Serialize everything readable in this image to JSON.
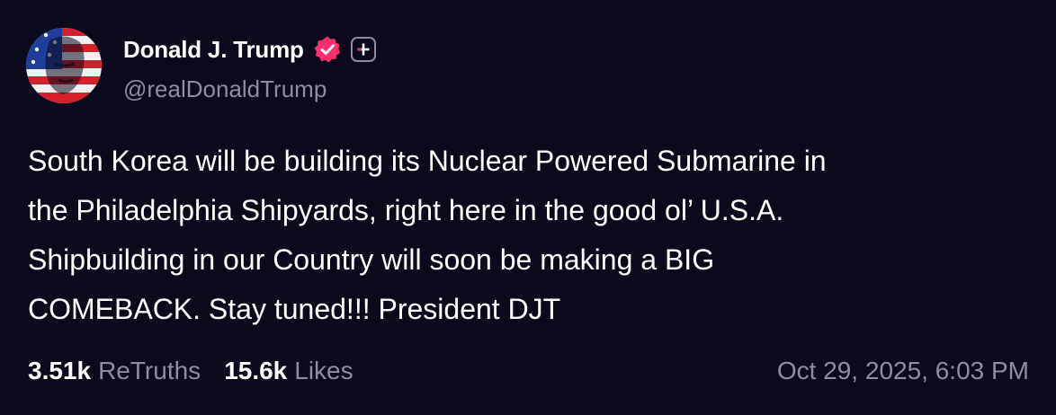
{
  "author": {
    "display_name": "Donald J. Trump",
    "handle": "@realDonaldTrump",
    "verified_icon": "verified-badge-icon",
    "plus_icon": "plus-badge-icon",
    "accent_color": "#ff2e6d"
  },
  "post": {
    "lines": [
      "South Korea will be building its Nuclear Powered Submarine in",
      "the Philadelphia Shipyards, right here in the good ol’ U.S.A.",
      "Shipbuilding in our Country will soon be making a BIG",
      "COMEBACK. Stay tuned!!! President DJT"
    ]
  },
  "stats": {
    "retruths_count": "3.51k",
    "retruths_label": "ReTruths",
    "likes_count": "15.6k",
    "likes_label": "Likes"
  },
  "timestamp": "Oct 29, 2025, 6:03 PM"
}
